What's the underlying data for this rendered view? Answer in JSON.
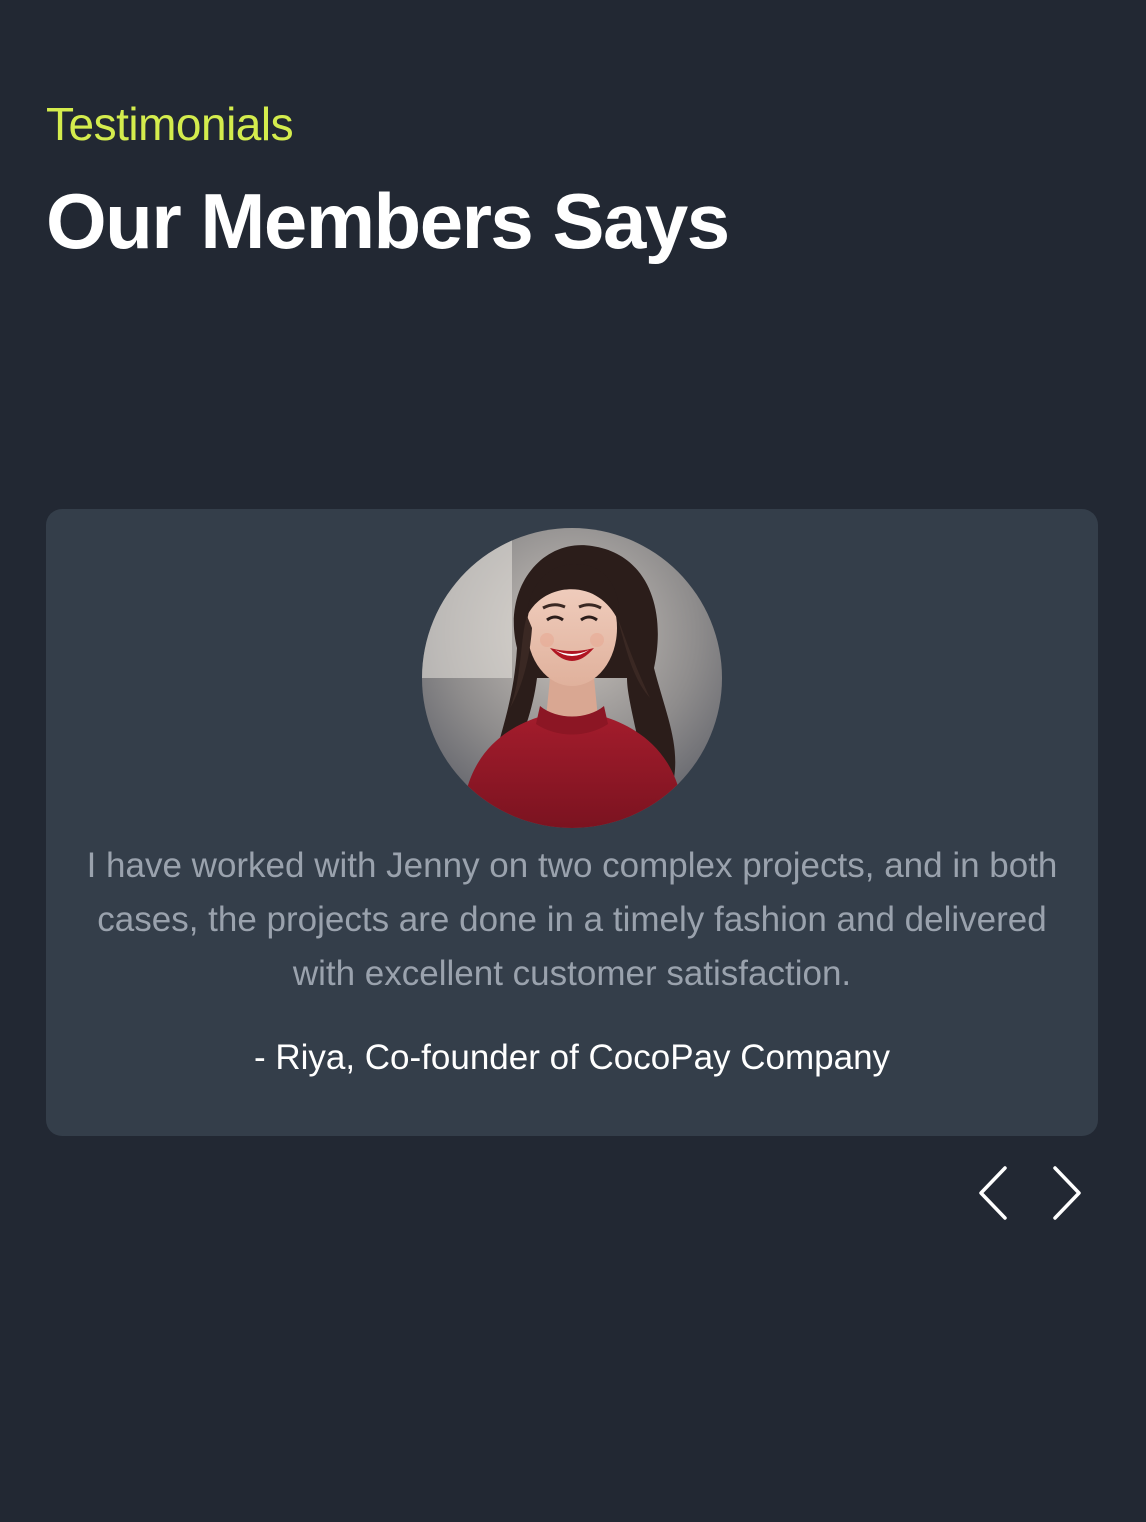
{
  "section": {
    "eyebrow": "Testimonials",
    "title": "Our Members Says"
  },
  "testimonial": {
    "quote": "I have worked with Jenny on two complex projects, and in both cases, the projects are done in a timely fashion and delivered with excellent customer satisfaction.",
    "author": "- Riya, Co-founder of CocoPay Company",
    "avatar_icon": "woman-portrait-photo"
  },
  "navigation": {
    "prev_icon": "chevron-left-icon",
    "next_icon": "chevron-right-icon"
  },
  "colors": {
    "background": "#222833",
    "card": "#343e4a",
    "accent": "#d4ec4d",
    "quote_text": "#9aa2ad",
    "heading_text": "#ffffff"
  }
}
